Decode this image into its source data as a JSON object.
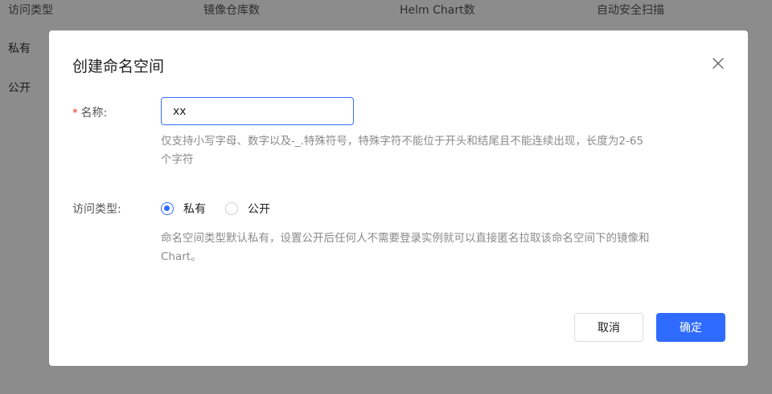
{
  "background_table": {
    "headers": [
      "访问类型",
      "镜像仓库数",
      "Helm Chart数",
      "自动安全扫描"
    ],
    "rows": [
      {
        "access": "私有"
      },
      {
        "access": "公开"
      }
    ]
  },
  "dialog": {
    "title": "创建命名空间",
    "name_field": {
      "required_mark": "*",
      "label": "名称:",
      "value": "xx",
      "hint_line1": "仅支持小写字母、数字以及-_.特殊符号，特殊字符不能位于开头和结尾且不能连续出现，长度为2-65",
      "hint_line2": "个字符"
    },
    "access_field": {
      "label": "访问类型:",
      "options": [
        {
          "label": "私有",
          "selected": true
        },
        {
          "label": "公开",
          "selected": false
        }
      ],
      "hint_line1": "命名空间类型默认私有，设置公开后任何人不需要登录实例就可以直接匿名拉取该命名空间下的镜像和",
      "hint_line2": "Chart。"
    },
    "cancel_label": "取消",
    "ok_label": "确定"
  },
  "colors": {
    "primary": "#2f6bff",
    "required": "#e5342b",
    "hint": "#8a8a8a"
  }
}
